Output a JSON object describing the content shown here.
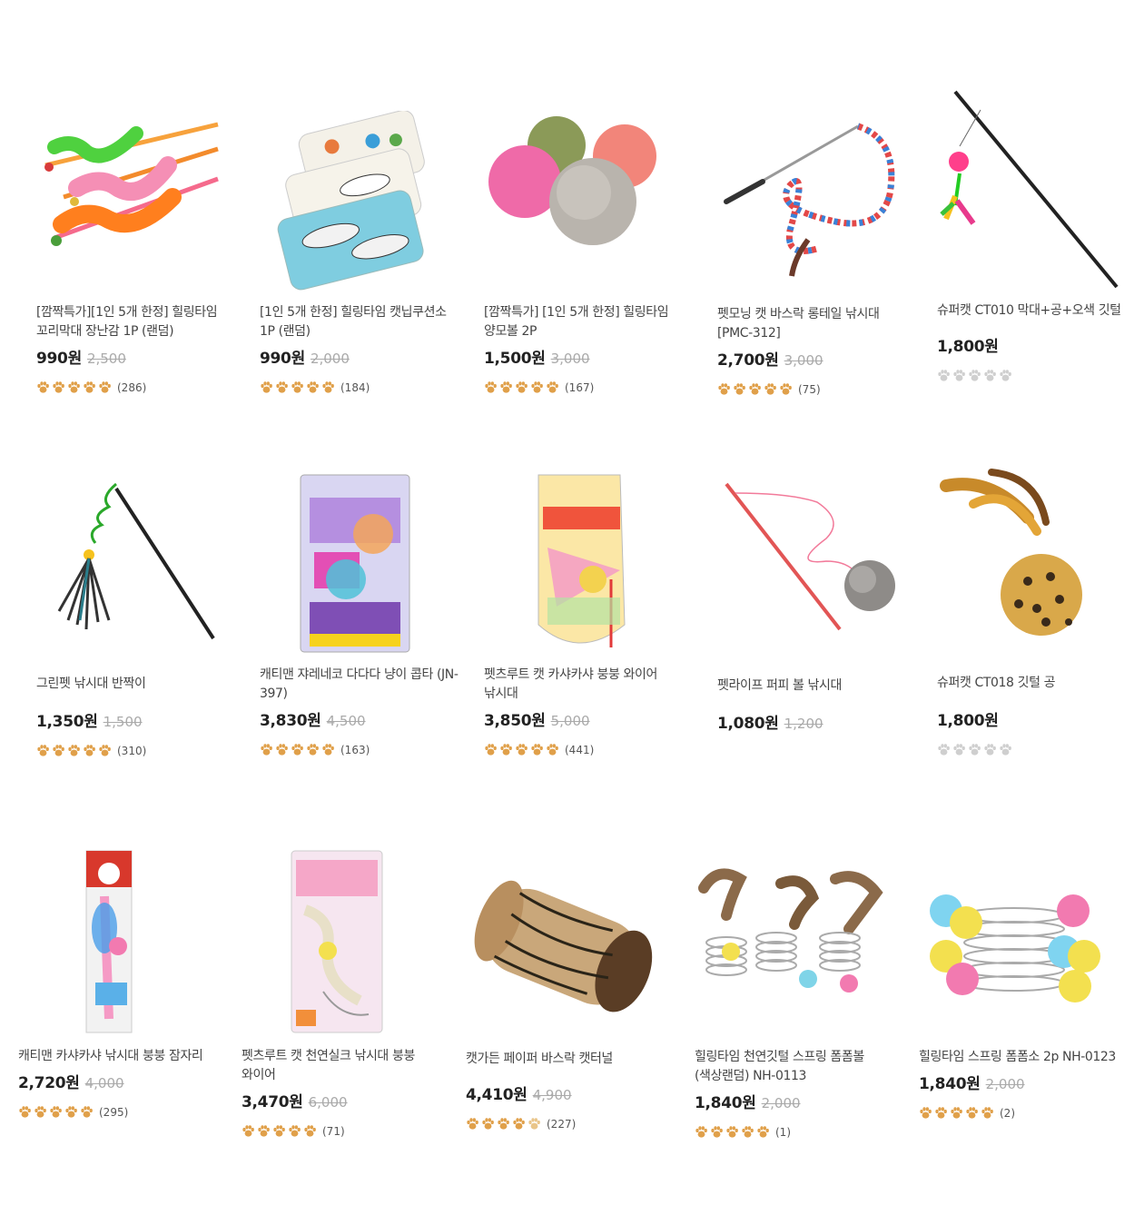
{
  "colors": {
    "paw_active": "#e0a04a",
    "paw_inactive": "#cfcfcf"
  },
  "products": [
    {
      "title": "[깜짝특가][1인 5개 한정] 힐링타임 꼬리막대 장난감 1P (랜덤)",
      "price": "990원",
      "orig": "2,500",
      "rating": 5,
      "count": "(286)",
      "image": "wand-worms-icon"
    },
    {
      "title": "[1인 5개 한정] 힐링타임 캣닙쿠션소 1P (랜덤)",
      "price": "990원",
      "orig": "2,000",
      "rating": 5,
      "count": "(184)",
      "image": "fish-cushion-icon"
    },
    {
      "title": "[깜짝특가] [1인 5개 한정] 힐링타임 양모볼 2P",
      "price": "1,500원",
      "orig": "3,000",
      "rating": 5,
      "count": "(167)",
      "image": "wool-balls-icon"
    },
    {
      "title": "펫모닝 캣 바스락 롱테일 낚시대 [PMC-312]",
      "price": "2,700원",
      "orig": "3,000",
      "rating": 5,
      "count": "(75)",
      "image": "rainbow-wand-icon"
    },
    {
      "title": "슈퍼캣 CT010 막대+공+오색 깃털",
      "price": "1,800원",
      "orig": "",
      "rating": 0,
      "count": "",
      "image": "stick-ball-feather-icon"
    },
    {
      "title": "그린펫 낚시대 반짝이",
      "price": "1,350원",
      "orig": "1,500",
      "rating": 5,
      "count": "(310)",
      "image": "tinsel-wand-icon"
    },
    {
      "title": "캐티맨 쟈레네코 다다다 냥이 콥타 (JN-397)",
      "price": "3,830원",
      "orig": "4,500",
      "rating": 5,
      "count": "(163)",
      "image": "copter-package-icon"
    },
    {
      "title": "펫츠루트 캣 카샤카샤 붕붕 와이어 낚시대",
      "price": "3,850원",
      "orig": "5,000",
      "rating": 5,
      "count": "(441)",
      "image": "kasha-package-icon"
    },
    {
      "title": "펫라이프 퍼피 볼 낚시대",
      "price": "1,080원",
      "orig": "1,200",
      "rating": 0,
      "count": "",
      "image": "pompom-wand-icon"
    },
    {
      "title": "슈퍼캣 CT018 깃털 공",
      "price": "1,800원",
      "orig": "",
      "rating": 0,
      "count": "",
      "image": "leopard-feather-ball-icon"
    },
    {
      "title": "캐티맨 카샤카샤 낚시대 붕붕 잠자리",
      "price": "2,720원",
      "orig": "4,000",
      "rating": 5,
      "count": "(295)",
      "image": "dragonfly-package-icon"
    },
    {
      "title": "펫츠루트 캣 천연실크 낚시대 붕붕 와이어",
      "price": "3,470원",
      "orig": "6,000",
      "rating": 5,
      "count": "(71)",
      "image": "silk-package-icon"
    },
    {
      "title": "캣가든 페이퍼 바스락 캣터널",
      "price": "4,410원",
      "orig": "4,900",
      "rating": 4.5,
      "count": "(227)",
      "image": "paper-tunnel-icon"
    },
    {
      "title": "힐링타임 천연깃털 스프링 폼폼볼(색상랜덤) NH-0113",
      "price": "1,840원",
      "orig": "2,000",
      "rating": 5,
      "count": "(1)",
      "image": "spring-feathers-icon"
    },
    {
      "title": "힐링타임 스프링 폼폼소 2p NH-0123",
      "price": "1,840원",
      "orig": "2,000",
      "rating": 5,
      "count": "(2)",
      "image": "spring-pompoms-icon"
    }
  ]
}
